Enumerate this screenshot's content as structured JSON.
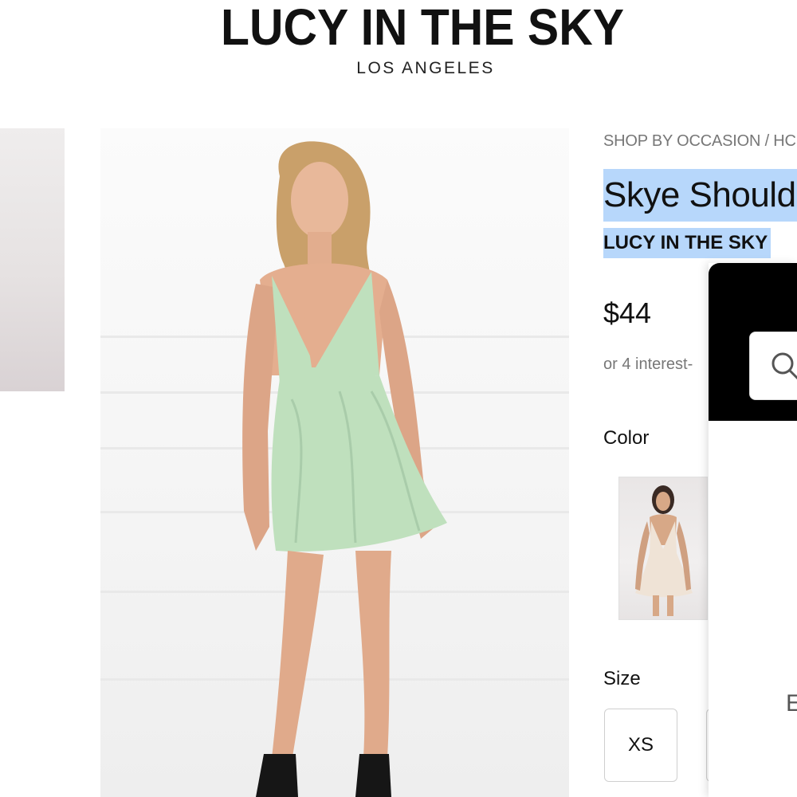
{
  "header": {
    "brand": "LUCY IN THE SKY",
    "location": "LOS ANGELES"
  },
  "breadcrumb": "SHOP BY OCCASION / HC",
  "product": {
    "title": "Skye Shoulde",
    "brand": "LUCY IN THE SKY",
    "price": "$44",
    "installment_text": "or 4 interest-"
  },
  "options": {
    "color_label": "Color",
    "size_label": "Size",
    "sizes": [
      "XS"
    ]
  },
  "overlay": {
    "partial_text": "E"
  },
  "colors": {
    "highlight": "#b7d7fb",
    "overlay_header": "#000000",
    "dress_green": "#bfe0bd"
  }
}
